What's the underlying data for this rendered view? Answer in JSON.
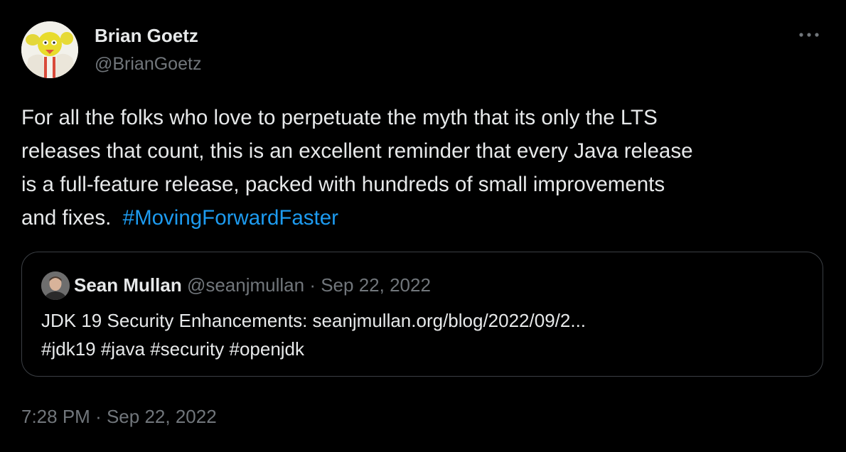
{
  "author": {
    "name": "Brian Goetz",
    "handle": "@BrianGoetz"
  },
  "icons": {
    "more": "more-horizontal-icon",
    "avatar": "avatar-image",
    "quote_avatar": "avatar-image"
  },
  "colors": {
    "background": "#000000",
    "text": "#e7e9ea",
    "muted": "#71767b",
    "link": "#1d9bf0",
    "border": "#3b3f44"
  },
  "tweet": {
    "text_lines": [
      "For all the folks who love to perpetuate the myth that its only the LTS",
      "releases that count, this is an excellent reminder that every Java release",
      "is a full-feature release, packed with hundreds of small improvements",
      "and fixes. "
    ],
    "hashtag": "#MovingForwardFaster"
  },
  "quote": {
    "name": "Sean Mullan",
    "handle": "@seanjmullan",
    "separator": "·",
    "date": "Sep 22, 2022",
    "text_lines": [
      "JDK 19 Security Enhancements: seanjmullan.org/blog/2022/09/2...",
      "#jdk19 #java #security #openjdk"
    ]
  },
  "timestamp": {
    "time": "7:28 PM",
    "separator": "·",
    "date": "Sep 22, 2022"
  }
}
